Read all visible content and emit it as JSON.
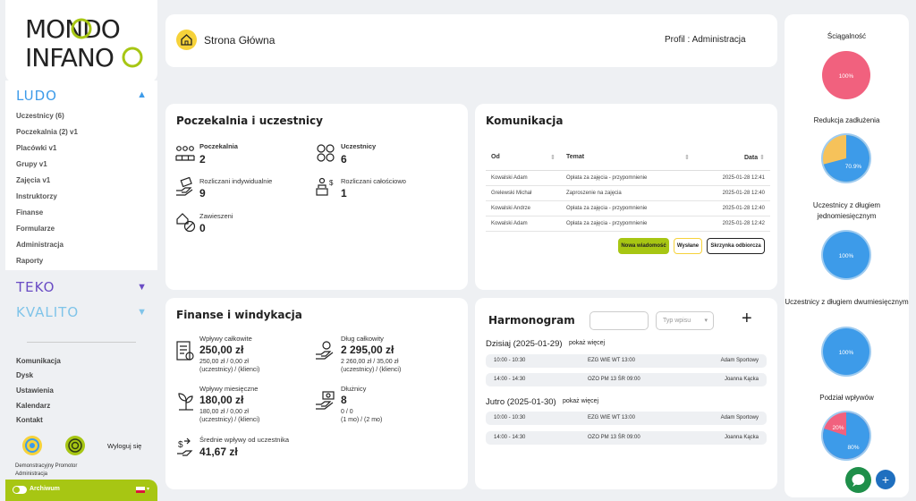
{
  "brand": {
    "logo_line1": "MONDO",
    "logo_line2": "INFANO"
  },
  "sidebar": {
    "ludo": "LUDO",
    "ludo_items": [
      "Uczestnicy (6)",
      "Poczekalnia (2) v1",
      "Placówki v1",
      "Grupy v1",
      "Zajęcia v1",
      "Instruktorzy",
      "Finanse",
      "Formularze",
      "Administracja",
      "Raporty"
    ],
    "teko": "TEKO",
    "kvalito": "KVALITO",
    "links": [
      "Komunikacja",
      "Dysk",
      "Ustawienia",
      "Kalendarz",
      "Kontakt"
    ],
    "user_role": "Demonstracyjny Promotor",
    "user_sub": "Administracja",
    "logout": "Wyloguj się",
    "archive": "Archiwum"
  },
  "header": {
    "page_title": "Strona Główna",
    "profile": "Profil : Administracja"
  },
  "waiting": {
    "title": "Poczekalnia i uczestnicy",
    "poczekalnia_label": "Poczekalnia",
    "poczekalnia_value": "2",
    "uczestnicy_label": "Uczestnicy",
    "uczestnicy_value": "6",
    "indyw_label": "Rozliczani indywidualnie",
    "indyw_value": "9",
    "calosc_label": "Rozliczani całościowo",
    "calosc_value": "1",
    "zawieszeni_label": "Zawieszeni",
    "zawieszeni_value": "0"
  },
  "comm": {
    "title": "Komunikacja",
    "columns": [
      "Od",
      "Temat",
      "Data"
    ],
    "rows": [
      [
        "Kowalski Adam",
        "Opłata za zajęcia - przypomnienie",
        "2025-01-28 12:41"
      ],
      [
        "Grelewski Michał",
        "Zaproszenie na zajęcia",
        "2025-01-28 12:40"
      ],
      [
        "Kowalski Andrze",
        "Opłata za zajęcia - przypomnienie",
        "2025-01-28 12:40"
      ],
      [
        "Kowalski Adam",
        "Opłata za zajęcia - przypomnienie",
        "2025-01-28 12:42"
      ]
    ],
    "btn_new": "Nowa wiadomość",
    "btn_sent": "Wysłane",
    "btn_inbox": "Skrzynka odbiorcza"
  },
  "finance": {
    "title": "Finanse i windykacja",
    "wplywy_label": "Wpływy całkowite",
    "wplywy_value": "250,00 zł",
    "wplywy_sub1": "250,00 zł / 0,00 zł",
    "wplywy_sub2": "(uczestnicy) / (klienci)",
    "dlug_label": "Dług całkowity",
    "dlug_value": "2 295,00 zł",
    "dlug_sub1": "2 260,00 zł / 35,00 zł",
    "dlug_sub2": "(uczestnicy) / (klienci)",
    "mies_label": "Wpływy miesięczne",
    "mies_value": "180,00 zł",
    "mies_sub1": "180,00 zł / 0,00 zł",
    "mies_sub2": "(uczestnicy) / (klienci)",
    "dluznicy_label": "Dłużnicy",
    "dluznicy_value": "8",
    "dluznicy_sub1": "0 / 0",
    "dluznicy_sub2": "(1 mo) / (2 mo)",
    "srednie_label": "Średnie wpływy od uczestnika",
    "srednie_value": "41,67 zł"
  },
  "schedule": {
    "title": "Harmonogram",
    "type_placeholder": "Typ wpisu",
    "plus": "+",
    "today_label": "Dzisiaj (2025-01-29)",
    "tomorrow_label": "Jutro (2025-01-30)",
    "show_more": "pokaż więcej",
    "today": [
      [
        "10:00 - 10:30",
        "EZG WIE WT 13:00",
        "Adam Sportowy"
      ],
      [
        "14:00 - 14:30",
        "OZO PM 13 ŚR 09:00",
        "Joanna Kącka"
      ]
    ],
    "tomorrow": [
      [
        "10:00 - 10:30",
        "EZG WIE WT 13:00",
        "Adam Sportowy"
      ],
      [
        "14:00 - 14:30",
        "OZO PM 13 ŚR 09:00",
        "Joanna Kącka"
      ]
    ]
  },
  "right": {
    "s1_title": "Ściągalność",
    "s1_label": "100%",
    "s2_title": "Redukcja zadłużenia",
    "s2_label": "70.9%",
    "s2_value": 70.9,
    "s3_title": "Uczestnicy z długiem jednomiesięcznym",
    "s3_label": "100%",
    "s4_title": "Uczestnicy z długiem dwumiesięcznym",
    "s4_label": "100%",
    "s5_title": "Podział wpływów",
    "s5_label_a": "20%",
    "s5_label_b": "80%",
    "s5_value": 80
  },
  "colors": {
    "accent": "#a7c613",
    "pink": "#f1617e",
    "blue": "#3d9be9",
    "yellow": "#f6c25a",
    "purple": "#6a4cc4"
  }
}
